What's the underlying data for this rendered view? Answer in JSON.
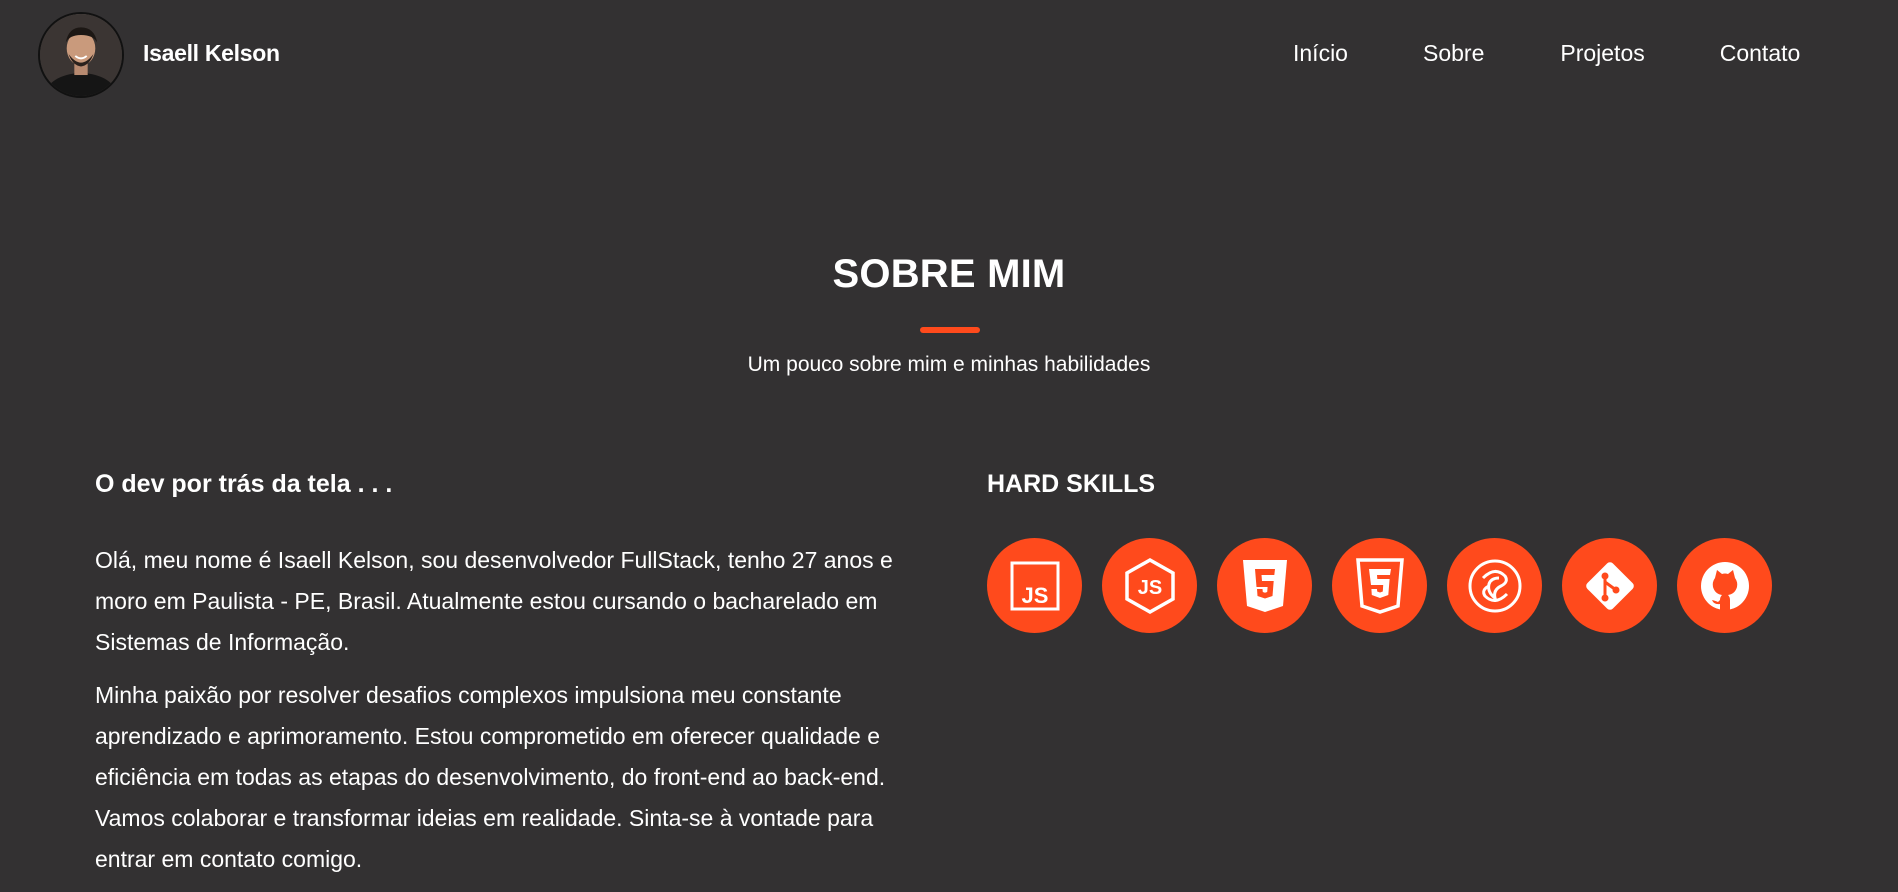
{
  "header": {
    "name": "Isaell Kelson",
    "avatar_icon": "profile-photo",
    "nav": [
      "Início",
      "Sobre",
      "Projetos",
      "Contato"
    ]
  },
  "about": {
    "title": "SOBRE MIM",
    "subtitle": "Um pouco sobre mim e minhas habilidades",
    "accent_color": "#ff4a1c",
    "intro_heading": "O dev por trás da tela . . .",
    "paragraphs": [
      "Olá, meu nome é Isaell Kelson, sou desenvolvedor FullStack, tenho 27 anos e moro em Paulista - PE, Brasil. Atualmente estou cursando o bacharelado em Sistemas de Informação.",
      "Minha paixão por resolver desafios complexos impulsiona meu constante aprendizado e aprimoramento. Estou comprometido em oferecer qualidade e eficiência em todas as etapas do desenvolvimento, do front-end ao back-end. Vamos colaborar e transformar ideias em realidade. Sinta-se à vontade para entrar em contato comigo."
    ],
    "skills_heading": "HARD SKILLS",
    "skills": [
      "javascript-icon",
      "nodejs-icon",
      "html5-icon",
      "css3-icon",
      "mysql-icon",
      "git-icon",
      "github-icon"
    ]
  },
  "colors": {
    "background": "#333132",
    "accent": "#ff4a1c",
    "text": "#ffffff"
  }
}
